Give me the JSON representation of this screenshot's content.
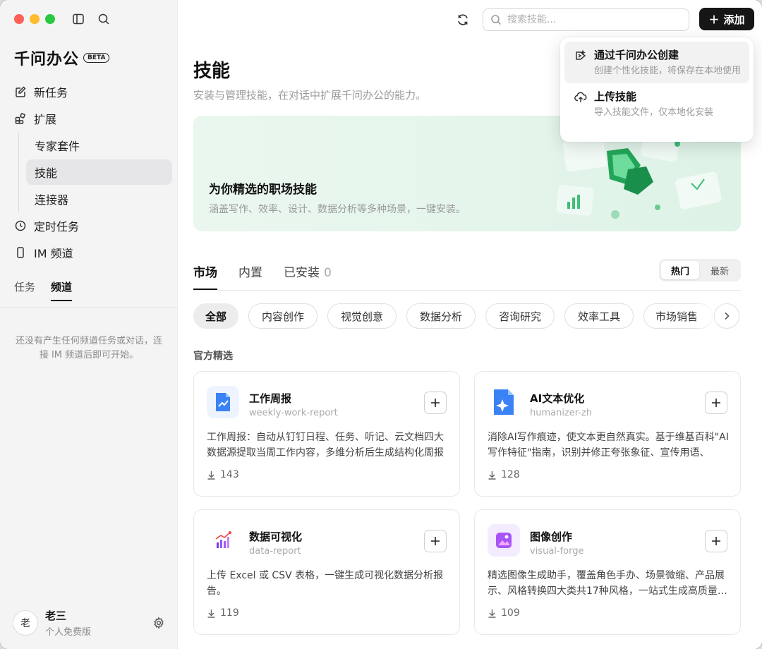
{
  "sidebar": {
    "brand": "千问办公",
    "beta": "BETA",
    "nav": {
      "new_task": "新任务",
      "extensions": "扩展",
      "sub": [
        "专家套件",
        "技能",
        "连接器"
      ],
      "scheduled": "定时任务",
      "im_channel": "IM 频道"
    },
    "tabs": [
      "任务",
      "频道"
    ],
    "empty_text": "还没有产生任何频道任务或对话，连接 IM 频道后即可开始。",
    "user": {
      "avatar": "老",
      "name": "老三",
      "plan": "个人免费版"
    }
  },
  "header": {
    "search_placeholder": "搜索技能...",
    "add_label": "添加"
  },
  "page": {
    "title": "技能",
    "subtitle": "安装与管理技能，在对话中扩展千问办公的能力。"
  },
  "banner": {
    "title": "为你精选的职场技能",
    "subtitle": "涵盖写作、效率、设计、数据分析等多种场景，一键安装。"
  },
  "tabs": {
    "market": "市场",
    "builtin": "内置",
    "installed": "已安装",
    "installed_count": "0"
  },
  "sort": {
    "hot": "热门",
    "latest": "最新"
  },
  "categories": [
    "全部",
    "内容创作",
    "视觉创意",
    "数据分析",
    "咨询研究",
    "效率工具",
    "市场销售"
  ],
  "section_label": "官方精选",
  "cards": [
    {
      "title": "工作周报",
      "slug": "weekly-work-report",
      "desc": "工作周报：自动从钉钉日程、任务、听记、云文档四大数据源提取当周工作内容，多维分析后生成结构化周报",
      "downloads": "143",
      "icon": "chart-doc-icon"
    },
    {
      "title": "AI文本优化",
      "slug": "humanizer-zh",
      "desc": "消除AI写作痕迹，使文本更自然真实。基于维基百科\"AI写作特征\"指南，识别并修正夸张象征、宣传用语、肤…",
      "downloads": "128",
      "icon": "sparkle-doc-icon"
    },
    {
      "title": "数据可视化",
      "slug": "data-report",
      "desc": "上传 Excel 或 CSV 表格，一键生成可视化数据分析报告。",
      "downloads": "119",
      "icon": "bar-trend-icon"
    },
    {
      "title": "图像创作",
      "slug": "visual-forge",
      "desc": "精选图像生成助手，覆盖角色手办、场景微缩、产品展示、风格转换四大类共17种风格，一站式生成高质量…",
      "downloads": "109",
      "icon": "image-icon"
    }
  ],
  "dropdown": {
    "items": [
      {
        "title": "通过千问办公创建",
        "desc": "创建个性化技能，将保存在本地使用"
      },
      {
        "title": "上传技能",
        "desc": "导入技能文件，仅本地化安装"
      }
    ]
  },
  "colors": {
    "accent_green": "#22a559",
    "dark_button": "#161616"
  }
}
